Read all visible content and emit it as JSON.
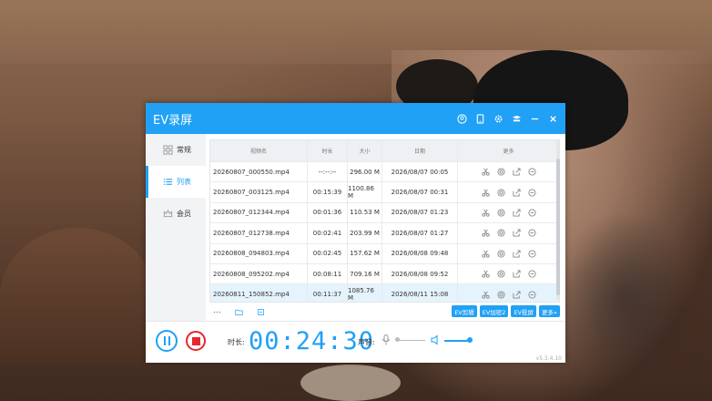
{
  "window": {
    "title": "EV录屏",
    "accent": "#20a1f5",
    "title_icons": [
      "user-icon",
      "device-icon",
      "settings-icon",
      "skin-icon",
      "minimize-icon",
      "close-icon"
    ]
  },
  "sidebar": {
    "items": [
      {
        "label": "常规",
        "icon": "grid-icon"
      },
      {
        "label": "列表",
        "icon": "list-icon"
      },
      {
        "label": "会员",
        "icon": "crown-icon"
      }
    ]
  },
  "table": {
    "headers": [
      "视频名",
      "时长",
      "大小",
      "日期",
      "更多"
    ],
    "rows": [
      {
        "name": "20260807_000550.mp4",
        "duration": "--:--:--",
        "size": "296.00 M",
        "date": "2026/08/07 00:05"
      },
      {
        "name": "20260807_003125.mp4",
        "duration": "00:15:39",
        "size": "1100.86 M",
        "date": "2026/08/07 00:31"
      },
      {
        "name": "20260807_012344.mp4",
        "duration": "00:01:36",
        "size": "110.53 M",
        "date": "2026/08/07 01:23"
      },
      {
        "name": "20260807_012738.mp4",
        "duration": "00:02:41",
        "size": "203.99 M",
        "date": "2026/08/07 01:27"
      },
      {
        "name": "20260808_094803.mp4",
        "duration": "00:02:45",
        "size": "157.62 M",
        "date": "2026/08/08 09:48"
      },
      {
        "name": "20260808_095202.mp4",
        "duration": "00:08:11",
        "size": "709.16 M",
        "date": "2026/08/08 09:52"
      },
      {
        "name": "20260811_150852.mp4",
        "duration": "00:11:37",
        "size": "1085.76 M",
        "date": "2026/08/11 15:08"
      }
    ],
    "row_actions": [
      "cut-icon",
      "play-icon",
      "share-icon",
      "delete-icon"
    ]
  },
  "toolbar": {
    "buttons": [
      "EV剪辑",
      "EV加密2",
      "EV投屏",
      "更多»"
    ]
  },
  "footer": {
    "duration_label": "时长:",
    "timer": "00:24:30",
    "sound_label": "声音:",
    "version": "v5.3.4.10"
  }
}
